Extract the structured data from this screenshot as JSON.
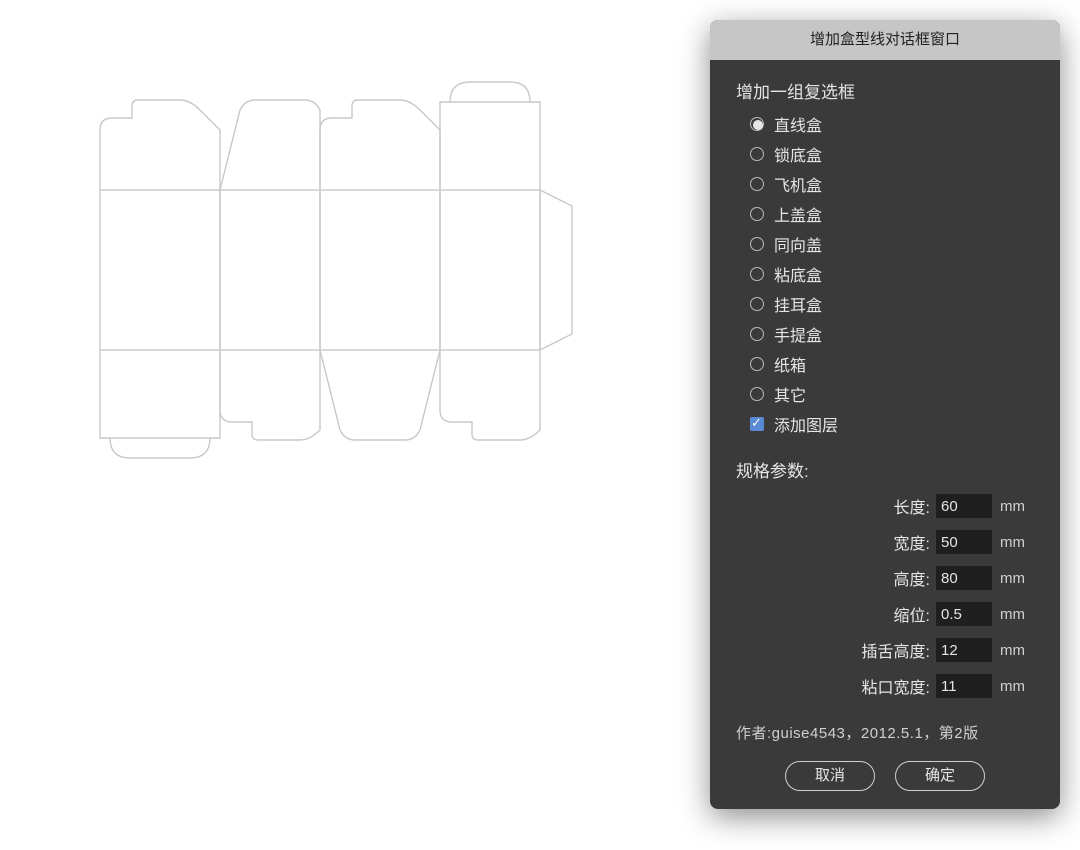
{
  "dialog": {
    "title": "增加盒型线对话框窗口",
    "group_title": "增加一组复选框",
    "options": [
      {
        "label": "直线盒",
        "selected": true
      },
      {
        "label": "锁底盒",
        "selected": false
      },
      {
        "label": "飞机盒",
        "selected": false
      },
      {
        "label": "上盖盒",
        "selected": false
      },
      {
        "label": "同向盖",
        "selected": false
      },
      {
        "label": "粘底盒",
        "selected": false
      },
      {
        "label": "挂耳盒",
        "selected": false
      },
      {
        "label": "手提盒",
        "selected": false
      },
      {
        "label": "纸箱",
        "selected": false
      },
      {
        "label": "其它",
        "selected": false
      }
    ],
    "checkbox": {
      "label": "添加图层",
      "checked": true
    },
    "params_title": "规格参数:",
    "params": [
      {
        "label": "长度:",
        "value": "60",
        "unit": "mm"
      },
      {
        "label": "宽度:",
        "value": "50",
        "unit": "mm"
      },
      {
        "label": "高度:",
        "value": "80",
        "unit": "mm"
      },
      {
        "label": "缩位:",
        "value": "0.5",
        "unit": "mm"
      },
      {
        "label": "插舌高度:",
        "value": "12",
        "unit": "mm"
      },
      {
        "label": "粘口宽度:",
        "value": "11",
        "unit": "mm"
      }
    ],
    "footer": "作者:guise4543，2012.5.1，第2版",
    "buttons": {
      "cancel": "取消",
      "ok": "确定"
    }
  }
}
